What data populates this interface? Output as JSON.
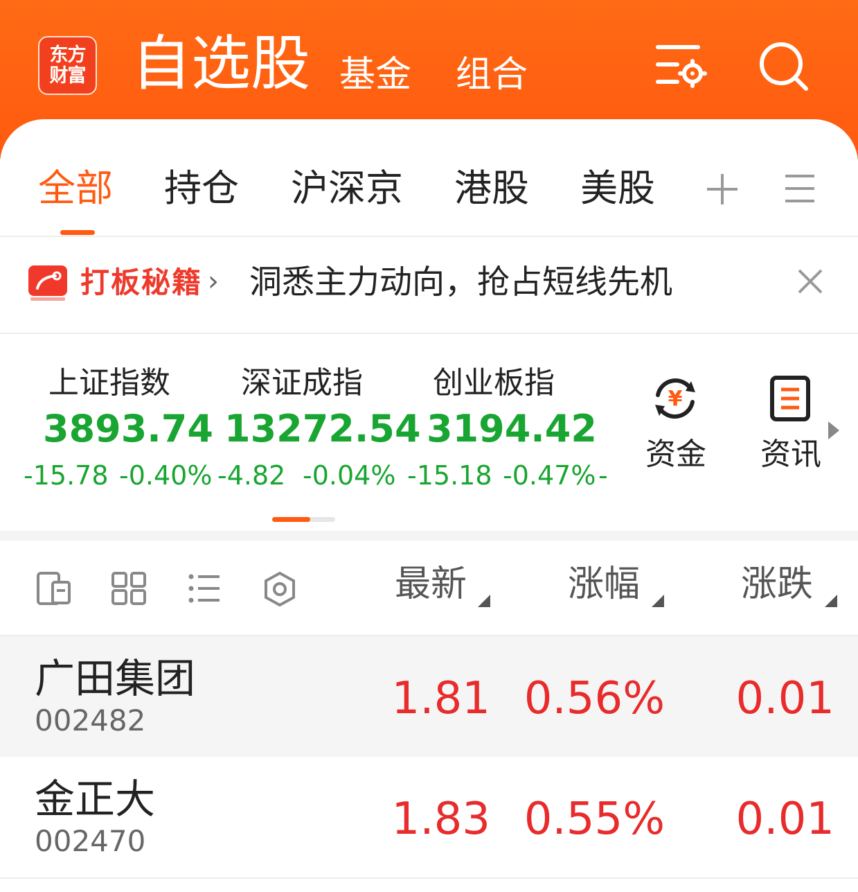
{
  "app": {
    "logo_line1": "东方",
    "logo_line2": "财富",
    "title": "自选股",
    "tabs": [
      "基金",
      "组合"
    ]
  },
  "category_tabs": [
    "全部",
    "持仓",
    "沪深京",
    "港股",
    "美股"
  ],
  "banner": {
    "title": "打板秘籍",
    "text": "洞悉主力动向，抢占短线先机"
  },
  "indices": [
    {
      "name": "上证指数",
      "value": "3893.74",
      "change": "-15.78",
      "pct": "-0.40%"
    },
    {
      "name": "深证成指",
      "value": "13272.54",
      "change": "-4.82",
      "pct": "-0.04%"
    },
    {
      "name": "创业板指",
      "value": "3194.42",
      "change": "-15.18",
      "pct": "-0.47%"
    }
  ],
  "trailing_dash": "-",
  "side": {
    "funds": "资金",
    "news": "资讯"
  },
  "columns": {
    "latest": "最新",
    "pct": "涨幅",
    "change": "涨跌"
  },
  "stocks": [
    {
      "name": "广田集团",
      "code": "002482",
      "latest": "1.81",
      "pct": "0.56%",
      "change": "0.01"
    },
    {
      "name": "金正大",
      "code": "002470",
      "latest": "1.83",
      "pct": "0.55%",
      "change": "0.01"
    }
  ],
  "colors": {
    "brand": "#ff5a0f",
    "down": "#19a531",
    "up": "#e82b2b"
  }
}
